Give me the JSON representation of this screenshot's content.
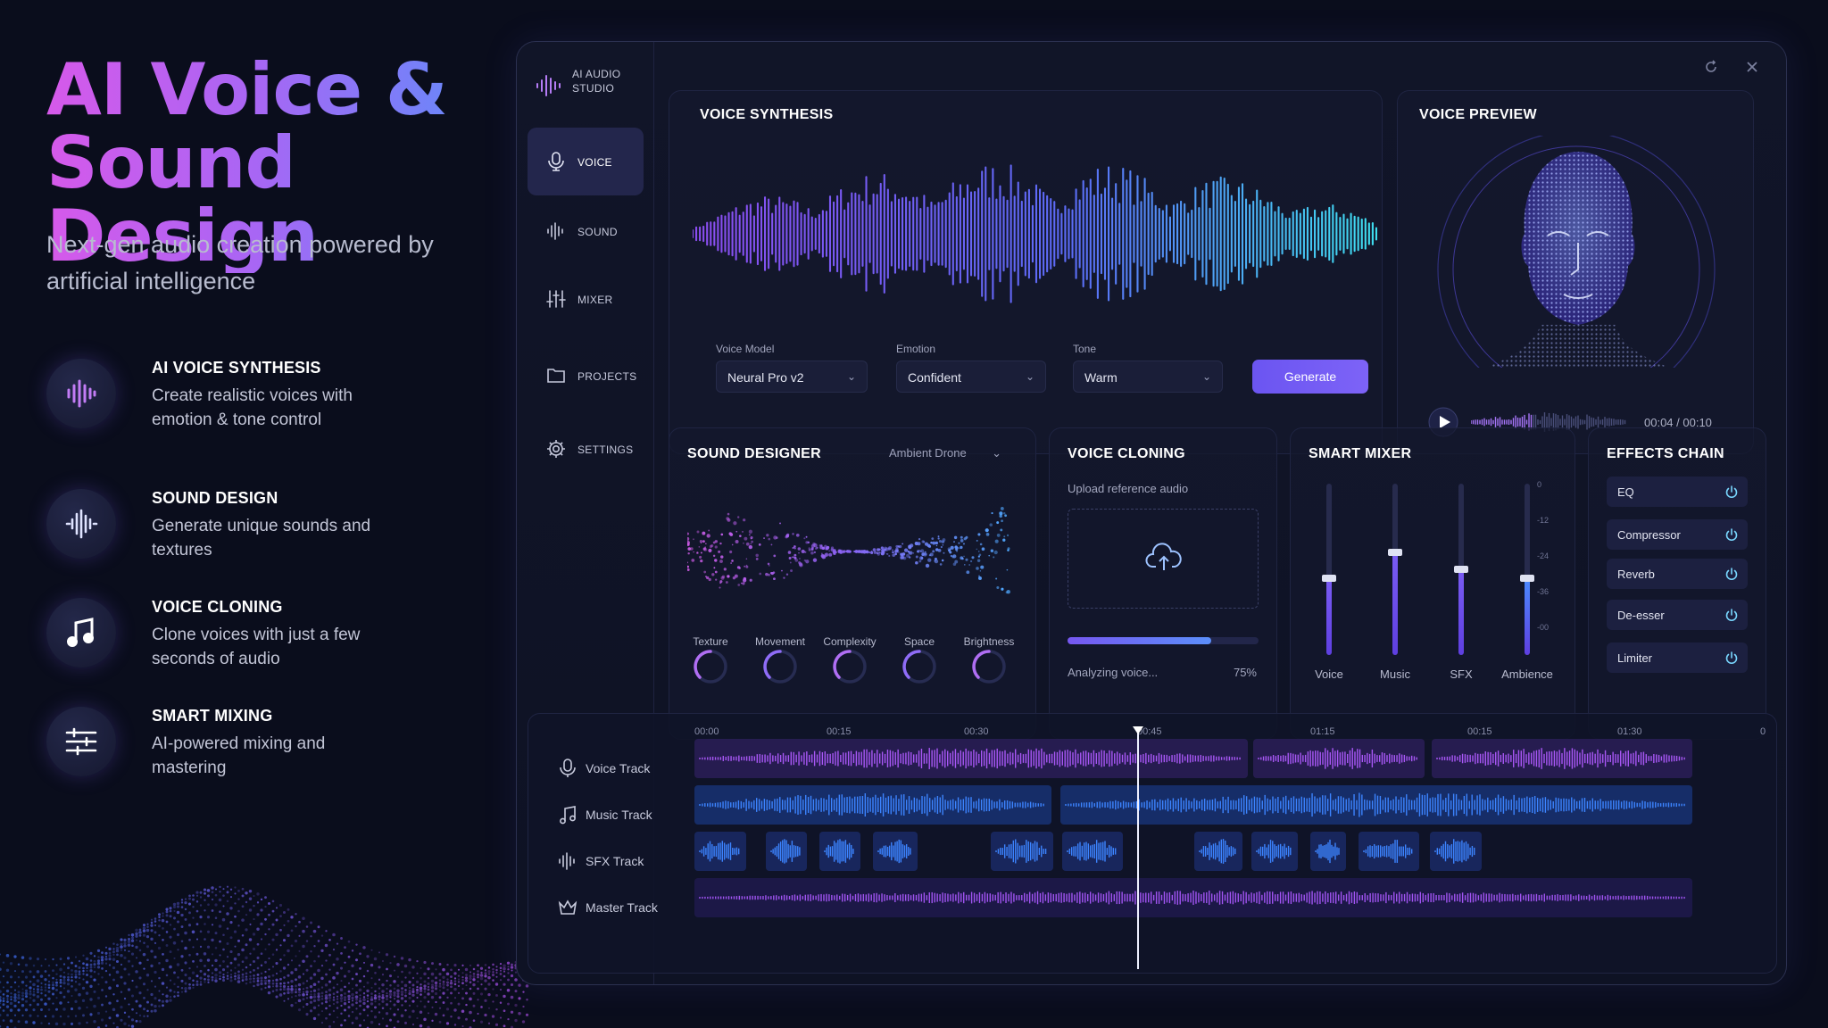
{
  "hero": {
    "title": "AI Voice & Sound Design",
    "subtitle": "Next-gen audio creation powered by artificial intelligence"
  },
  "features": [
    {
      "icon": "waveform-icon",
      "title": "AI VOICE SYNTHESIS",
      "desc": "Create realistic voices with emotion & tone control"
    },
    {
      "icon": "sound-wave-icon",
      "title": "SOUND DESIGN",
      "desc": "Generate unique sounds and textures"
    },
    {
      "icon": "music-note-icon",
      "title": "VOICE CLONING",
      "desc": "Clone voices with just a few seconds of audio"
    },
    {
      "icon": "sliders-icon",
      "title": "SMART MIXING",
      "desc": "AI-powered mixing and mastering"
    }
  ],
  "app": {
    "brand": "AI AUDIO STUDIO",
    "nav": [
      {
        "label": "VOICE",
        "icon": "microphone-icon",
        "active": true
      },
      {
        "label": "SOUND",
        "icon": "sound-wave-icon",
        "active": false
      },
      {
        "label": "MIXER",
        "icon": "mixer-icon",
        "active": false
      },
      {
        "label": "PROJECTS",
        "icon": "folder-icon",
        "active": false
      },
      {
        "label": "SETTINGS",
        "icon": "gear-icon",
        "active": false
      }
    ]
  },
  "voice_synthesis": {
    "title": "VOICE SYNTHESIS",
    "model_label": "Voice Model",
    "model_value": "Neural Pro v2",
    "emotion_label": "Emotion",
    "emotion_value": "Confident",
    "tone_label": "Tone",
    "tone_value": "Warm",
    "generate_label": "Generate"
  },
  "voice_preview": {
    "title": "VOICE PREVIEW",
    "time": "00:04 / 00:10",
    "progress": 0.4
  },
  "sound_designer": {
    "title": "SOUND DESIGNER",
    "preset": "Ambient Drone",
    "knobs": [
      "Texture",
      "Movement",
      "Complexity",
      "Space",
      "Brightness"
    ]
  },
  "voice_cloning": {
    "title": "VOICE CLONING",
    "upload_label": "Upload reference audio",
    "status": "Analyzing voice...",
    "percent": "75%",
    "progress": 0.75
  },
  "smart_mixer": {
    "title": "SMART MIXER",
    "scale": [
      "0",
      "-12",
      "-24",
      "-36",
      "-00"
    ],
    "faders": [
      {
        "label": "Voice",
        "level": 0.45
      },
      {
        "label": "Music",
        "level": 0.6
      },
      {
        "label": "SFX",
        "level": 0.5
      },
      {
        "label": "Ambience",
        "level": 0.45
      }
    ]
  },
  "effects_chain": {
    "title": "EFFECTS CHAIN",
    "items": [
      "EQ",
      "Compressor",
      "Reverb",
      "De-esser",
      "Limiter"
    ]
  },
  "timeline": {
    "ticks": [
      "00:00",
      "00:15",
      "00:30",
      "00:45",
      "01:15",
      "00:15",
      "01:30",
      "0"
    ],
    "playhead": "00:45",
    "tracks": [
      {
        "label": "Voice Track",
        "icon": "microphone-icon"
      },
      {
        "label": "Music Track",
        "icon": "music-note-icon"
      },
      {
        "label": "SFX Track",
        "icon": "sound-wave-icon"
      },
      {
        "label": "Master Track",
        "icon": "crown-icon"
      }
    ]
  },
  "colors": {
    "accent": "#7d63f7",
    "purple": "#a256f0",
    "blue": "#3c84ff",
    "cyan": "#3ee0f0",
    "background": "#0a0d1c"
  }
}
